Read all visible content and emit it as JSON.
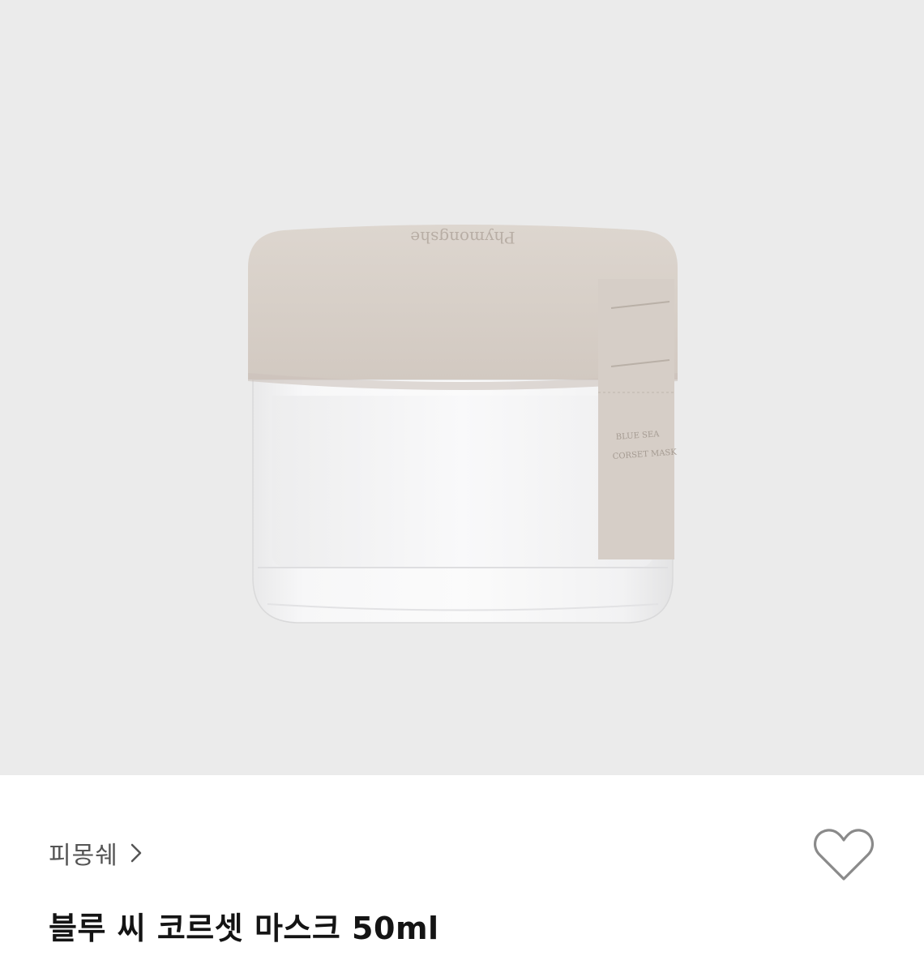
{
  "product": {
    "brand": "피몽쉐",
    "title": "블루 씨 코르셋 마스크 50ml",
    "jar_lid_logo": "Phymongshe",
    "jar_label_line1": "BLUE SEA",
    "jar_label_line2": "CORSET MASK"
  },
  "icons": {
    "brand_chevron": "chevron-right-icon",
    "wishlist": "heart-outline-icon"
  },
  "colors": {
    "hero_background": "#ebebeb",
    "lid": "#d8d0c9",
    "title_text": "#141414",
    "brand_text": "#555555"
  }
}
